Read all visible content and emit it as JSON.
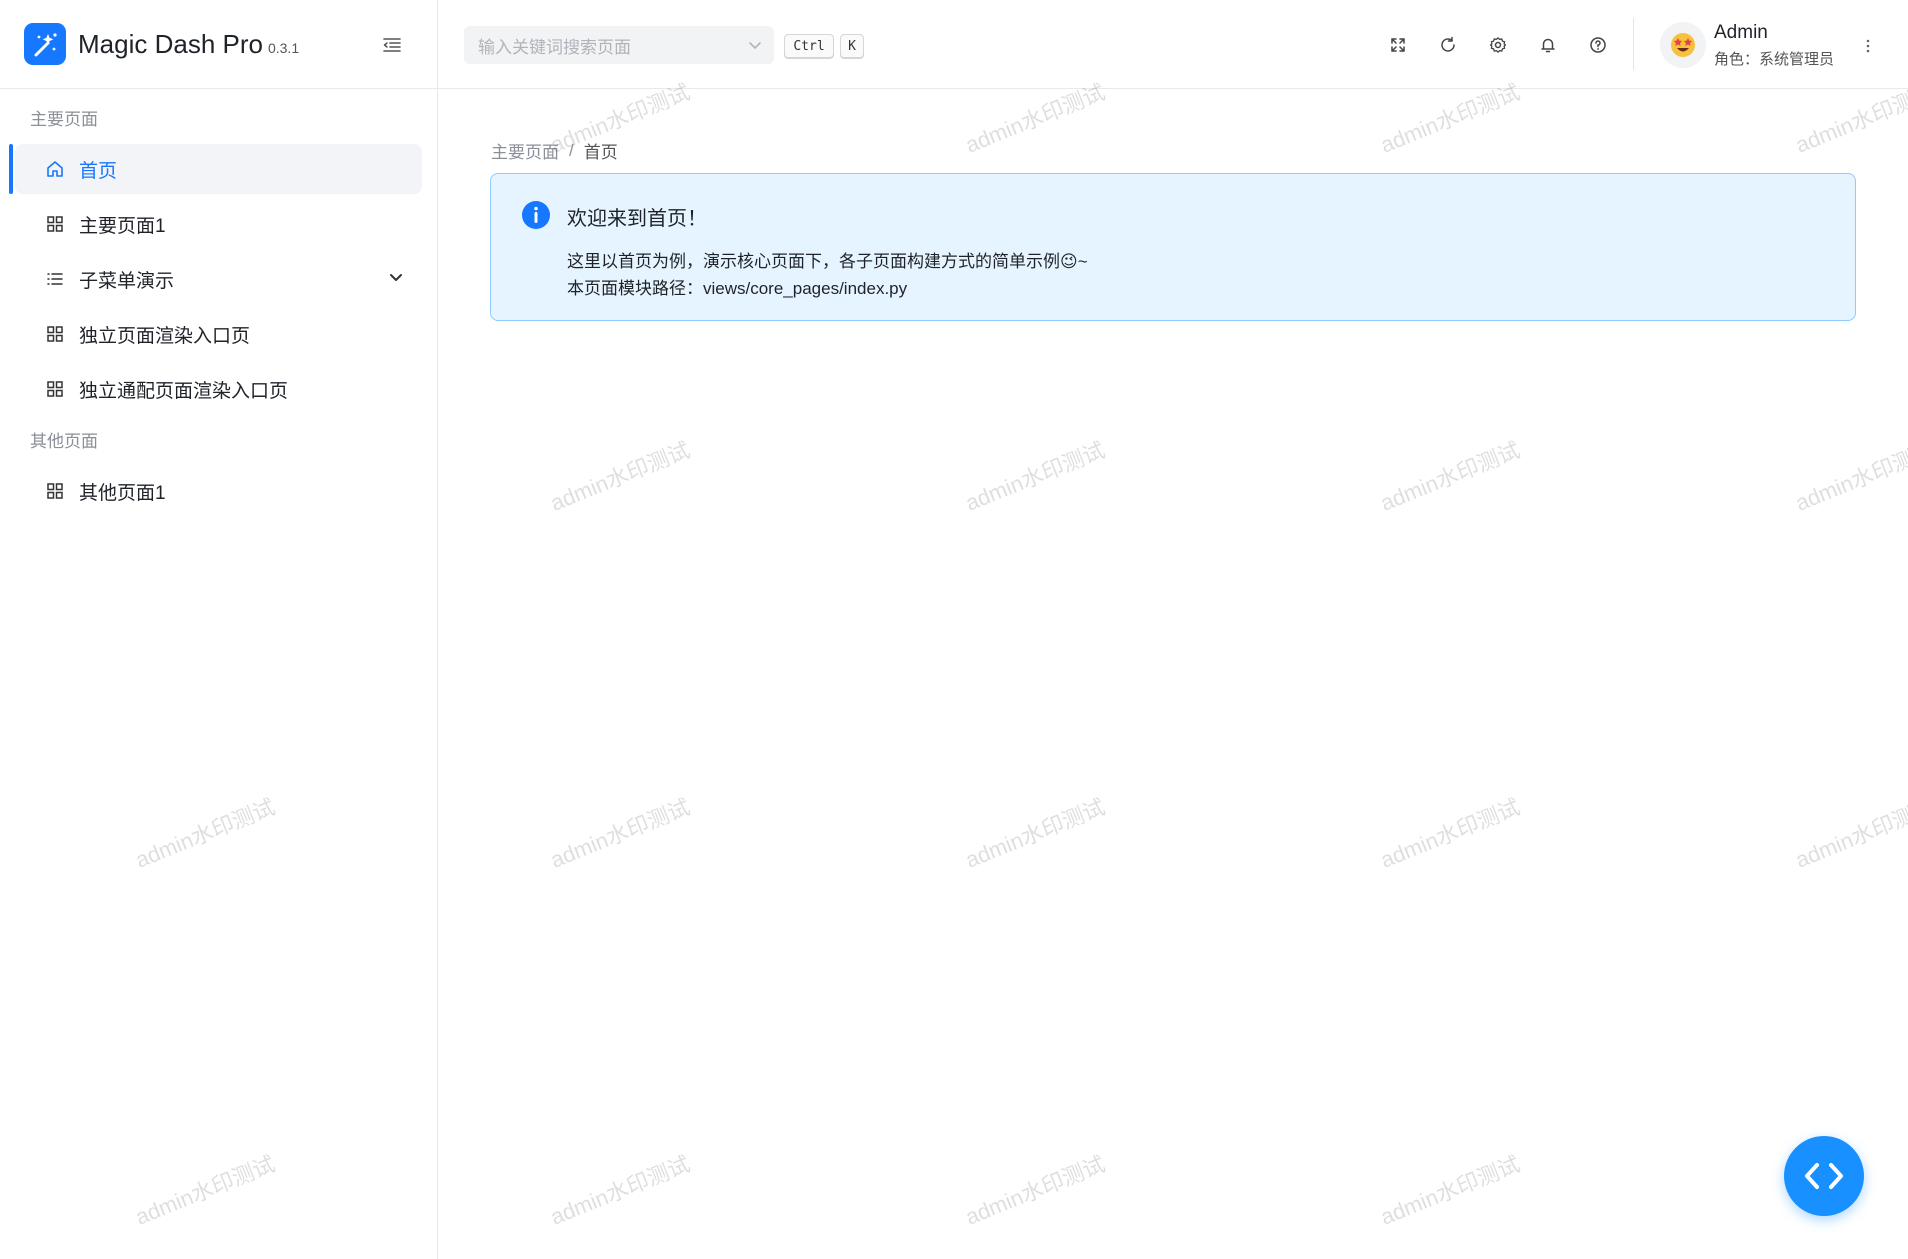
{
  "brand": {
    "title": "Magic Dash Pro",
    "version": "0.3.1"
  },
  "header": {
    "search_placeholder": "输入关键词搜索页面",
    "shortcut_ctrl": "Ctrl",
    "shortcut_key": "K",
    "user": {
      "name": "Admin",
      "role": "角色：系统管理员",
      "avatar": "star-struck-emoji"
    }
  },
  "sidebar": {
    "groups": [
      {
        "label": "主要页面"
      },
      {
        "label": "其他页面"
      }
    ],
    "items": [
      {
        "label": "首页",
        "icon": "home-icon",
        "active": true
      },
      {
        "label": "主要页面1",
        "icon": "grid-icon"
      },
      {
        "label": "子菜单演示",
        "icon": "list-icon",
        "has_children": true
      },
      {
        "label": "独立页面渲染入口页",
        "icon": "grid-icon"
      },
      {
        "label": "独立通配页面渲染入口页",
        "icon": "grid-icon"
      },
      {
        "label": "其他页面1",
        "icon": "grid-icon"
      }
    ]
  },
  "breadcrumb": {
    "parent": "主要页面",
    "separator": "/",
    "current": "首页"
  },
  "alert": {
    "title": "欢迎来到首页！",
    "line1": "这里以首页为例，演示核心页面下，各子页面构建方式的简单示例😉~",
    "line2": "本页面模块路径：views/core_pages/index.py"
  },
  "watermark": {
    "text": "admin水印测试"
  },
  "colors": {
    "accent": "#1677ff",
    "alert_bg": "#e6f4ff",
    "alert_border": "#91caff",
    "fab": "#1890ff"
  }
}
